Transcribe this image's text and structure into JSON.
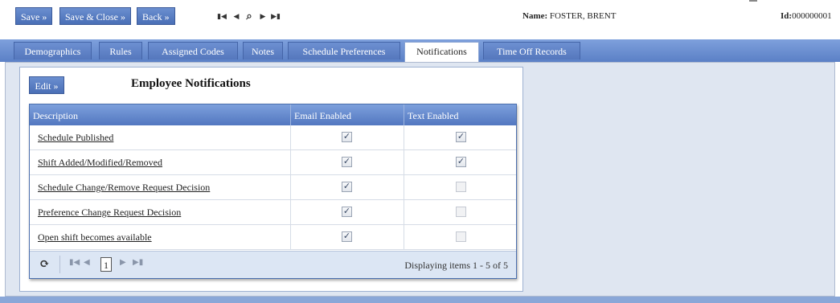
{
  "toolbar": {
    "save_label": "Save »",
    "save_close_label": "Save & Close »",
    "back_label": "Back »"
  },
  "record_nav": {
    "first_icon": "first-record-icon",
    "prev_icon": "prev-record-icon",
    "search_icon": "search-icon",
    "next_icon": "next-record-icon",
    "last_icon": "last-record-icon"
  },
  "employee": {
    "name_label": "Name:",
    "name_value": "FOSTER, BRENT",
    "id_label": "Id:",
    "id_value": "000000001"
  },
  "tabs": [
    {
      "label": "Demographics"
    },
    {
      "label": "Rules"
    },
    {
      "label": "Assigned Codes"
    },
    {
      "label": "Notes"
    },
    {
      "label": "Schedule Preferences"
    },
    {
      "label": "Notifications",
      "active": true
    },
    {
      "label": "Time Off Records"
    }
  ],
  "notifications": {
    "edit_label": "Edit »",
    "title": "Employee Notifications",
    "columns": [
      "Description",
      "Email Enabled",
      "Text Enabled"
    ],
    "rows": [
      {
        "description": "Schedule Published",
        "email": true,
        "text": true
      },
      {
        "description": "Shift Added/Modified/Removed",
        "email": true,
        "text": true
      },
      {
        "description": "Schedule Change/Remove Request Decision",
        "email": true,
        "text": false
      },
      {
        "description": "Preference Change Request Decision",
        "email": true,
        "text": false
      },
      {
        "description": "Open shift becomes available",
        "email": true,
        "text": false
      }
    ],
    "pager": {
      "current_page": "1",
      "display_text": "Displaying items 1 - 5 of 5"
    }
  },
  "colors": {
    "accent": "#5a7fc4",
    "tab_bar": "#6b8fd2",
    "panel_bg": "#dfe6f1",
    "pager_bg": "#dce6f4"
  }
}
